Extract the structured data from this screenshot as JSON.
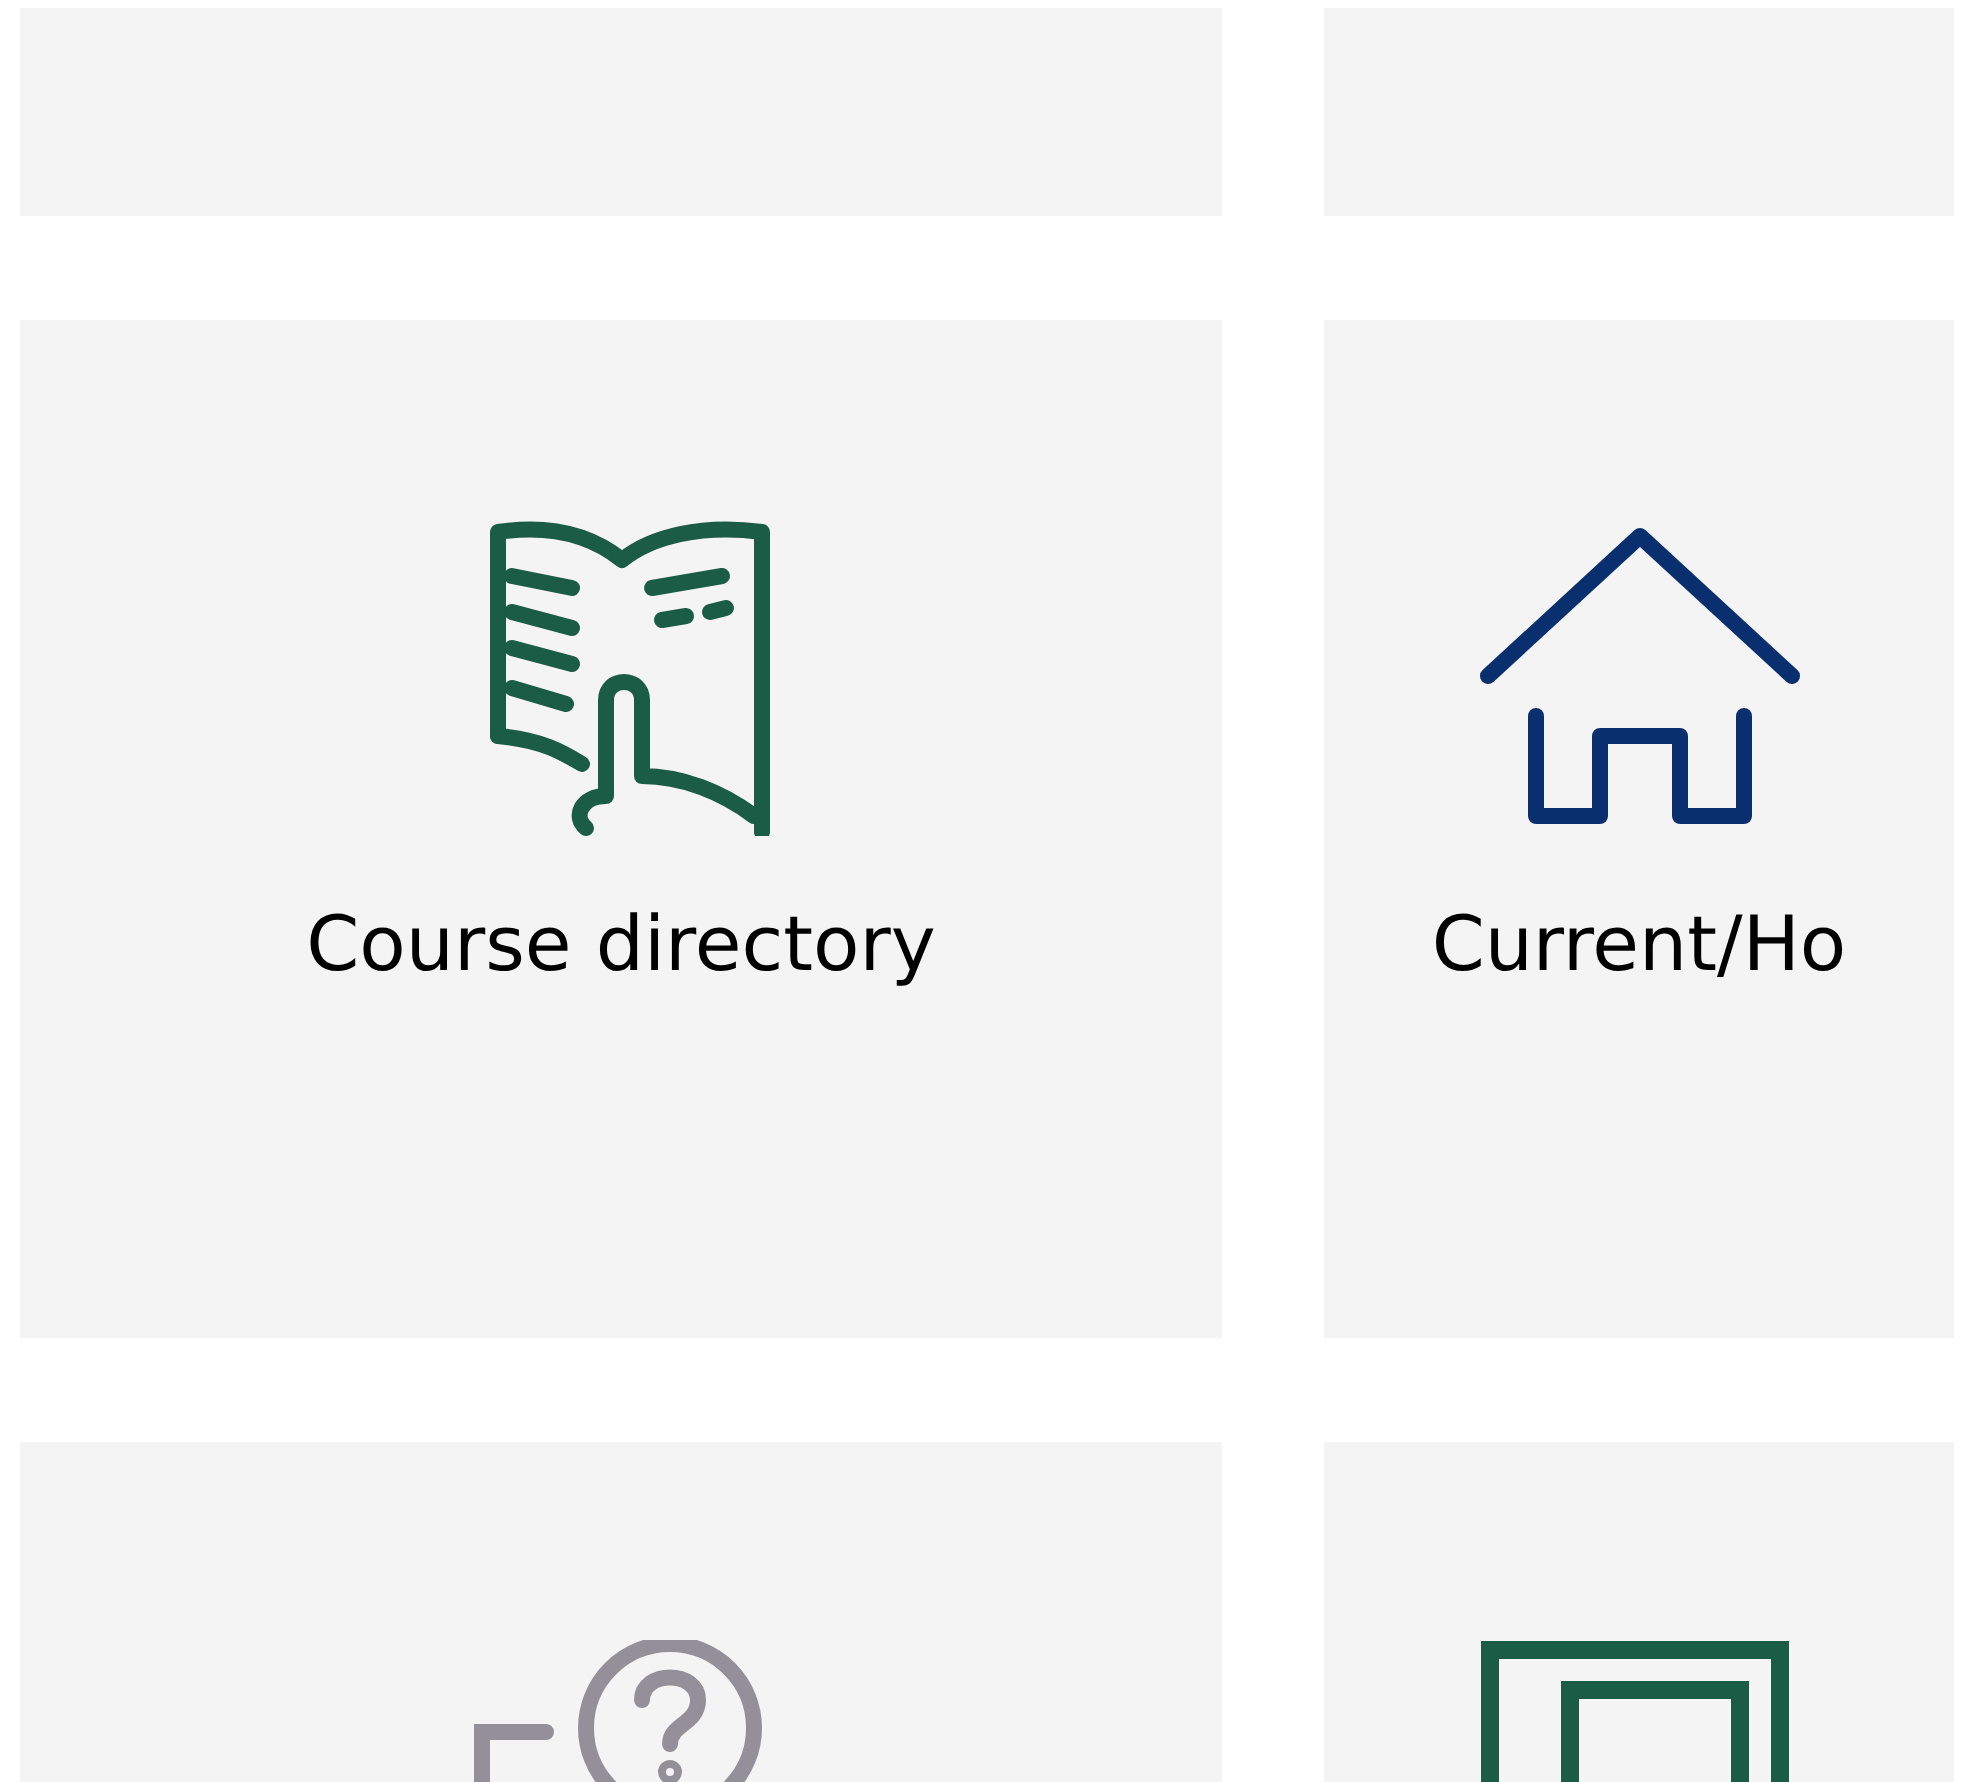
{
  "tiles": [
    {
      "kind": "blank"
    },
    {
      "kind": "blank"
    },
    {
      "kind": "book",
      "label": "Course directory",
      "color": "#1a5c45"
    },
    {
      "kind": "house",
      "label": "Current/Ho",
      "color": "#0a2f6e"
    },
    {
      "kind": "help",
      "color": "#939099"
    },
    {
      "kind": "document",
      "color": "#1a5c45"
    }
  ]
}
